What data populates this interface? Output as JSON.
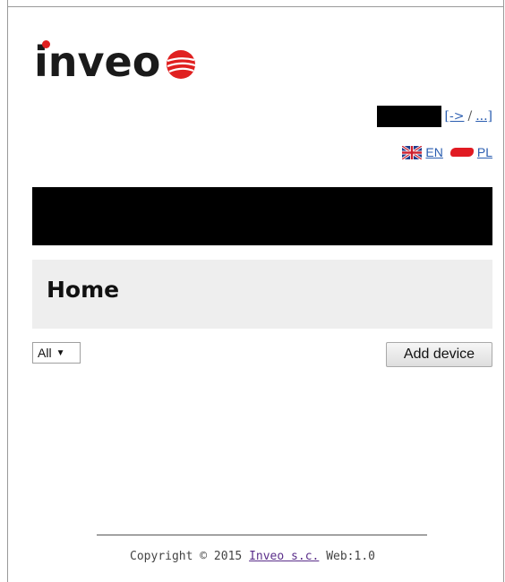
{
  "brand": {
    "name": "inveo",
    "accent": "#e02020",
    "icon": "globe-logo-icon"
  },
  "session": {
    "login_link": "[->",
    "separator": "/",
    "more_link": "...]"
  },
  "languages": [
    {
      "code": "EN",
      "flag_icon": "flag-uk-icon"
    },
    {
      "code": "PL",
      "flag_icon": "flag-pl-icon"
    }
  ],
  "page": {
    "title": "Home"
  },
  "filter": {
    "selected": "All"
  },
  "actions": {
    "add_device": "Add device"
  },
  "footer": {
    "prefix": "Copyright © 2015",
    "company": "Inveo s.c.",
    "suffix": "Web:1.0"
  }
}
